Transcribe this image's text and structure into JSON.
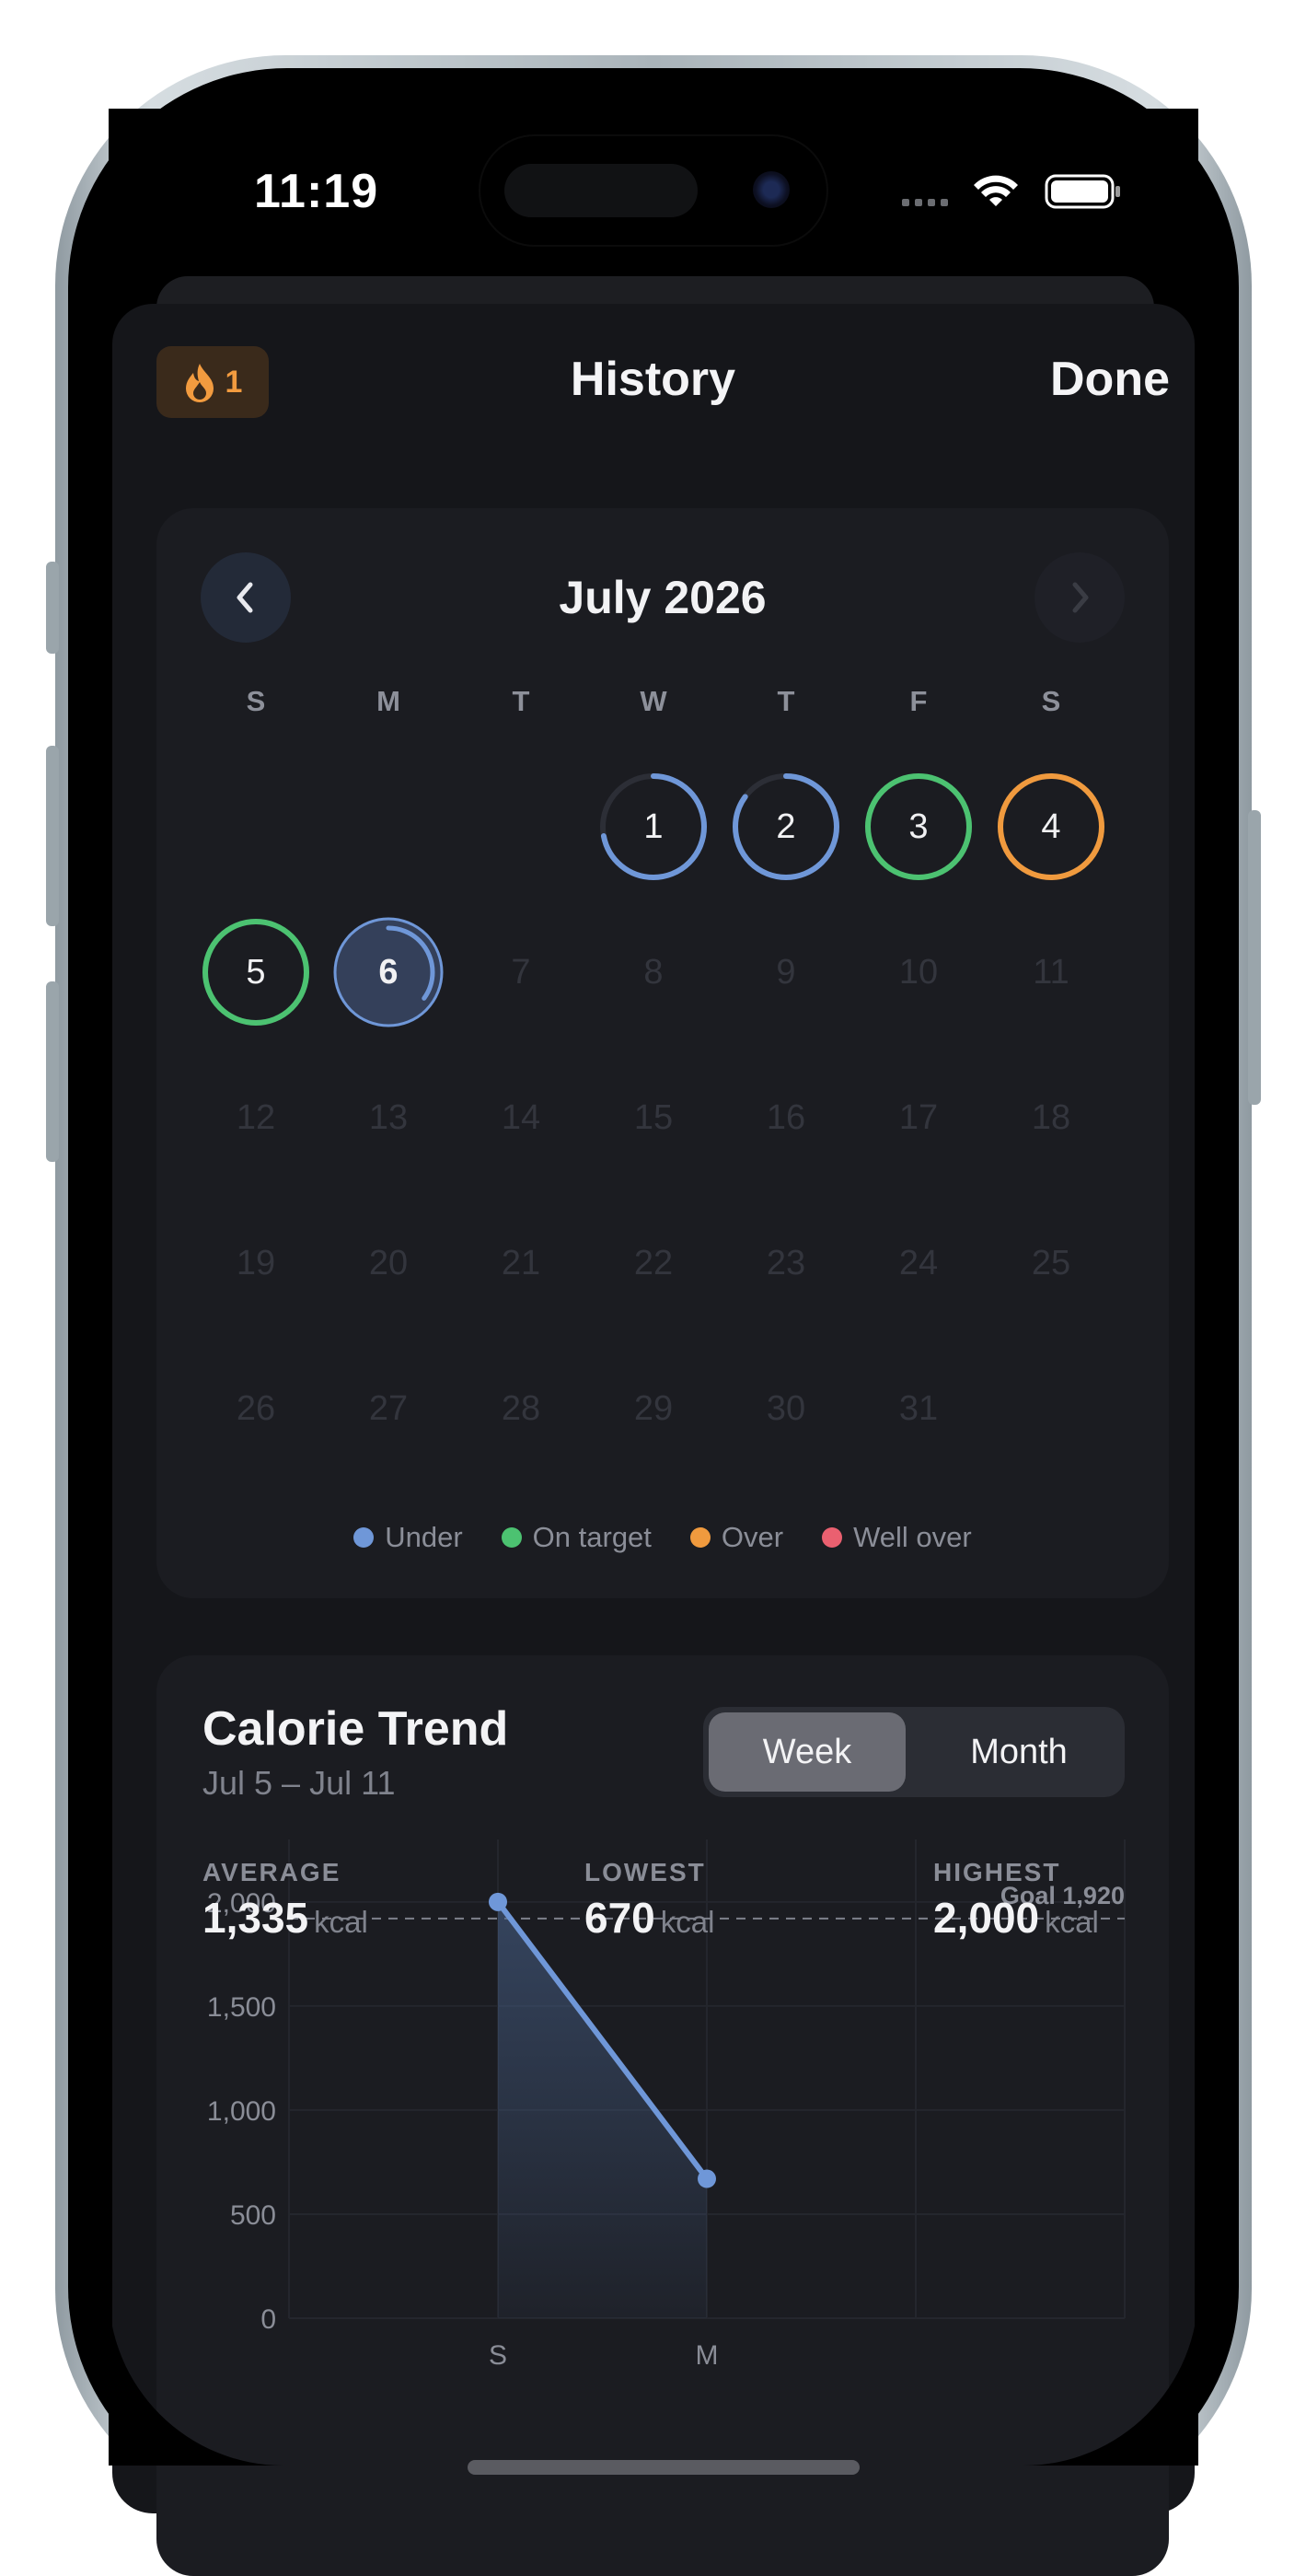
{
  "status_bar": {
    "time": "11:19"
  },
  "header": {
    "streak_count": "1",
    "title": "History",
    "done_label": "Done"
  },
  "calendar": {
    "month_label": "July 2026",
    "weekdays": [
      "S",
      "M",
      "T",
      "W",
      "T",
      "F",
      "S"
    ],
    "days": [
      {
        "n": "1",
        "status": "under",
        "progress": 0.72
      },
      {
        "n": "2",
        "status": "under",
        "progress": 0.85
      },
      {
        "n": "3",
        "status": "on_target",
        "progress": 1.0
      },
      {
        "n": "4",
        "status": "over",
        "progress": 1.0
      },
      {
        "n": "5",
        "status": "on_target",
        "progress": 1.0
      },
      {
        "n": "6",
        "status": "under",
        "progress": 0.35,
        "today": true
      },
      {
        "n": "7"
      },
      {
        "n": "8"
      },
      {
        "n": "9"
      },
      {
        "n": "10"
      },
      {
        "n": "11"
      },
      {
        "n": "12"
      },
      {
        "n": "13"
      },
      {
        "n": "14"
      },
      {
        "n": "15"
      },
      {
        "n": "16"
      },
      {
        "n": "17"
      },
      {
        "n": "18"
      },
      {
        "n": "19"
      },
      {
        "n": "20"
      },
      {
        "n": "21"
      },
      {
        "n": "22"
      },
      {
        "n": "23"
      },
      {
        "n": "24"
      },
      {
        "n": "25"
      },
      {
        "n": "26"
      },
      {
        "n": "27"
      },
      {
        "n": "28"
      },
      {
        "n": "29"
      },
      {
        "n": "30"
      },
      {
        "n": "31"
      }
    ],
    "legend": [
      {
        "label": "Under",
        "color": "#6f97d8"
      },
      {
        "label": "On target",
        "color": "#4cc271"
      },
      {
        "label": "Over",
        "color": "#f09a3e"
      },
      {
        "label": "Well over",
        "color": "#ea6070"
      }
    ]
  },
  "status_colors": {
    "under": "#6f97d8",
    "on_target": "#4cc271",
    "over": "#f09a3e",
    "well_over": "#ea6070"
  },
  "trend": {
    "title": "Calorie Trend",
    "range": "Jul 5 – Jul 11",
    "segments": [
      "Week",
      "Month"
    ],
    "selected_segment": "Week",
    "stats": [
      {
        "label": "AVERAGE",
        "value": "1,335",
        "unit": "kcal"
      },
      {
        "label": "LOWEST",
        "value": "670",
        "unit": "kcal"
      },
      {
        "label": "HIGHEST",
        "value": "2,000",
        "unit": "kcal"
      }
    ]
  },
  "chart_data": {
    "type": "line",
    "x": [
      "S",
      "M"
    ],
    "series": [
      {
        "values": [
          2000,
          670
        ]
      }
    ],
    "ylim": [
      0,
      2300
    ],
    "yticks": [
      0,
      500,
      1000,
      1500,
      2000
    ],
    "ytick_labels": [
      "0",
      "500",
      "1,000",
      "1,500",
      "2,000"
    ],
    "goal": {
      "value": 1920,
      "label": "Goal 1,920"
    },
    "line_color": "#6f97d8",
    "area_fill": true,
    "grid": true
  }
}
